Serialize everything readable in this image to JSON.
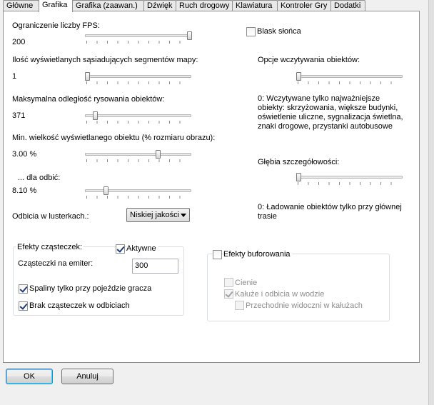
{
  "tabs": [
    {
      "label": "Główne"
    },
    {
      "label": "Grafika"
    },
    {
      "label": "Grafika (zaawan.)"
    },
    {
      "label": "Dźwięk"
    },
    {
      "label": "Ruch drogowy"
    },
    {
      "label": "Klawiatura"
    },
    {
      "label": "Kontroler Gry"
    },
    {
      "label": "Dodatki"
    }
  ],
  "active_tab": "Grafika",
  "left": {
    "fps": {
      "label": "Ograniczenie liczby FPS:",
      "value": "200",
      "level": 1.0
    },
    "segments": {
      "label": "Ilość wyświetlanych sąsiadujących segmentów mapy:",
      "value": "1",
      "level": 0.0
    },
    "draw_distance": {
      "label": "Maksymalna odległość rysowania obiektów:",
      "value": "371",
      "level": 0.08
    },
    "min_object": {
      "label": "Min. wielkość wyświetlanego obiektu (% rozmiaru obrazu):",
      "value": "3.00 %",
      "level": 0.69
    },
    "reflections_obj": {
      "label": "... dla odbić:",
      "value": "8.10 %",
      "level": 0.18
    },
    "mirror": {
      "label": "Odbicia w lusterkach.:",
      "selected": "Niskiej jakości"
    }
  },
  "right": {
    "sunlight": {
      "label": "Blask słońca",
      "checked": false
    },
    "loading": {
      "label": "Opcje wczytywania obiektów:",
      "level": 0.0,
      "description": "0: Wczytywane tylko najważniejsze obiekty: skrzyżowania, większe budynki, oświetlenie uliczne, sygnalizacja świetlna, znaki drogowe, przystanki autobusowe"
    },
    "detail": {
      "label": "Głębia szczegółowości:",
      "level": 0.0,
      "description": "0: Ładowanie obiektów tylko przy głównej trasie"
    }
  },
  "particles": {
    "title": "Efekty cząsteczek:",
    "active_label": "Aktywne",
    "active_checked": true,
    "emitter_label": "Cząsteczki na emiter:",
    "emitter_value": "300",
    "exhaust_label": "Spaliny tylko przy pojeździe gracza",
    "exhaust_checked": true,
    "no_reflection_label": "Brak cząsteczek w odbiciach",
    "no_reflection_checked": true
  },
  "buffered": {
    "title": "Efekty buforowania",
    "checked": false,
    "shadows_label": "Cienie",
    "shadows_checked": false,
    "puddles_label": "Kałuże i odbicia w wodzie",
    "puddles_checked": true,
    "passersby_label": "Przechodnie widoczni w kałużach",
    "passersby_checked": false
  },
  "buttons": {
    "ok": "OK",
    "cancel": "Anuluj"
  }
}
